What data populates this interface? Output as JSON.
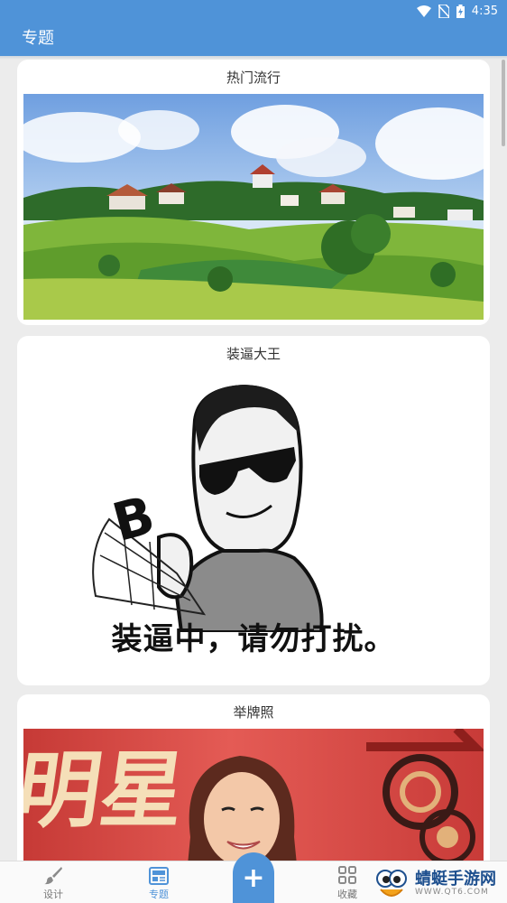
{
  "status_bar": {
    "time": "4:35",
    "icons": [
      "wifi-icon",
      "no-sim-icon",
      "battery-charging-icon"
    ]
  },
  "app_bar": {
    "title": "专题"
  },
  "cards": [
    {
      "title": "热门流行",
      "image": "green hillside village landscape"
    },
    {
      "title": "装逼大王",
      "image": "sunglasses meme",
      "meme_text": "装逼中，请勿打扰。"
    },
    {
      "title": "举牌照",
      "image": "woman smiling in front of red banner",
      "banner_text": "明星"
    }
  ],
  "bottom_nav": {
    "items": [
      {
        "label": "设计",
        "icon": "brush-icon",
        "active": false
      },
      {
        "label": "专题",
        "icon": "newspaper-icon",
        "active": true
      },
      {
        "label": "收藏",
        "icon": "grid-icon",
        "active": false
      }
    ],
    "fab_icon": "plus-icon"
  },
  "watermark": {
    "title": "蜻蜓手游网",
    "subtitle": "WWW.QT6.COM"
  },
  "colors": {
    "primary": "#4f93d8",
    "background": "#ececec",
    "card": "#ffffff"
  }
}
